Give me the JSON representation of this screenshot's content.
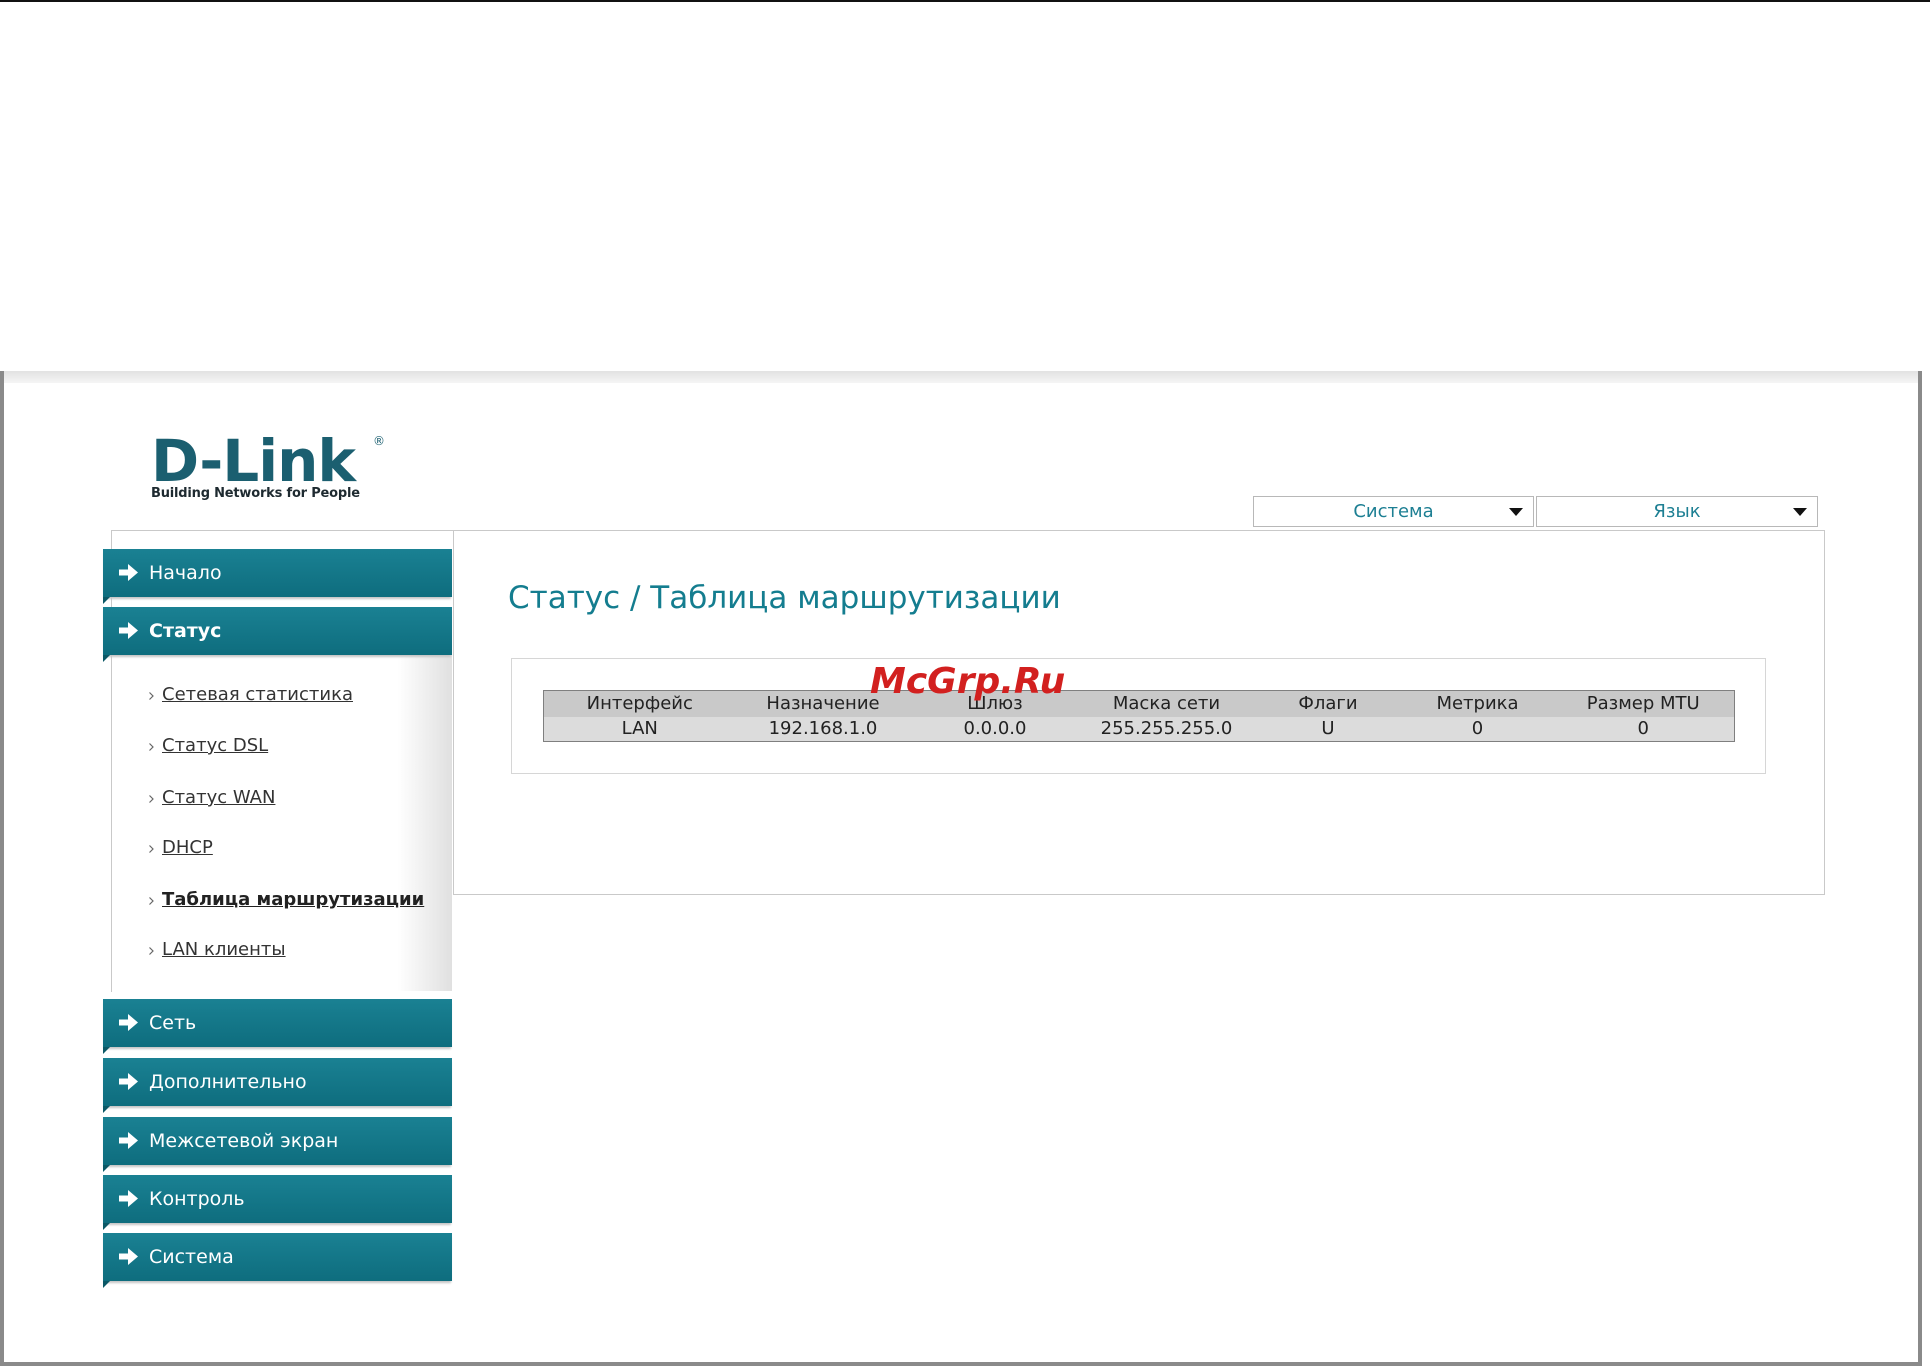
{
  "logo": {
    "brand": "D-Link",
    "registered_mark": "®",
    "tagline": "Building Networks for People"
  },
  "top_menu": {
    "system_label": "Система",
    "language_label": "Язык"
  },
  "sidebar": {
    "items": [
      {
        "label": "Начало"
      },
      {
        "label": "Статус",
        "expanded": true
      },
      {
        "label": "Сеть"
      },
      {
        "label": "Дополнительно"
      },
      {
        "label": "Межсетевой экран"
      },
      {
        "label": "Контроль"
      },
      {
        "label": "Система"
      }
    ],
    "status_submenu": [
      {
        "label": "Сетевая статистика"
      },
      {
        "label": "Статус DSL"
      },
      {
        "label": "Статус WAN"
      },
      {
        "label": "DHCP"
      },
      {
        "label": "Таблица маршрутизации",
        "active": true
      },
      {
        "label": "LAN клиенты"
      }
    ]
  },
  "main": {
    "title": "Статус / Таблица маршрутизации",
    "routing_table": {
      "columns": [
        "Интерфейс",
        "Назначение",
        "Шлюз",
        "Маска сети",
        "Флаги",
        "Метрика",
        "Размер MTU"
      ],
      "rows": [
        [
          "LAN",
          "192.168.1.0",
          "0.0.0.0",
          "255.255.255.0",
          "U",
          "0",
          "0"
        ]
      ]
    }
  },
  "watermark": "McGrp.Ru",
  "icons": {
    "nav_arrow": "arrow-right-icon",
    "dropdown": "caret-down-icon",
    "submenu_bullet": "chevron-right-icon"
  },
  "colors": {
    "accent": "#0f7183",
    "title": "#147d8f",
    "logo": "#1b5f70",
    "dropdown_text": "#1d7f93",
    "watermark": "#d2201f"
  }
}
